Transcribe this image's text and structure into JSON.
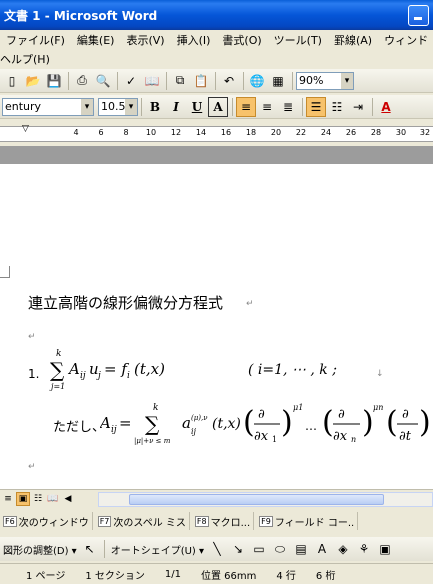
{
  "window": {
    "title": "文書 1 - Microsoft Word"
  },
  "menu": {
    "row1": [
      "ファイル(F)",
      "編集(E)",
      "表示(V)",
      "挿入(I)",
      "書式(O)",
      "ツール(T)",
      "罫線(A)",
      "ウィンド"
    ],
    "row2": [
      "ヘルプ(H)"
    ]
  },
  "standard_toolbar": {
    "zoom": "90%"
  },
  "format_toolbar": {
    "font": "entury",
    "size": "10.5"
  },
  "ruler": {
    "labels": [
      "4",
      "6",
      "8",
      "10",
      "12",
      "14",
      "16",
      "18",
      "20",
      "22",
      "24",
      "26",
      "28",
      "30",
      "32"
    ]
  },
  "document": {
    "heading": "連立高階の線形偏微分方程式",
    "eq_number": "1.",
    "eq_index": "( i=1, ⋯ , k ;",
    "note_prefix": "ただし、",
    "eq1_lhs": "A",
    "eq1_sum_upper": "k",
    "eq1_sum_lower": "j=1",
    "eq1_body": "A",
    "eq1_rhs": "= f",
    "eq2_lhs": "A",
    "eq2_sum_upper": "k",
    "eq2_sum_lower": "|μ|+ν ≤ m",
    "eq2_body": "a",
    "eq2_args": "(t,x)"
  },
  "fn_bar": [
    {
      "key": "F6",
      "label": "次のウィンドウ"
    },
    {
      "key": "F7",
      "label": "次のスペル ミス"
    },
    {
      "key": "F8",
      "label": "マクロ..."
    },
    {
      "key": "F9",
      "label": "フィールド コー.."
    }
  ],
  "drawing_toolbar": {
    "adjust": "図形の調整(D) ▾",
    "autoshape": "オートシェイプ(U) ▾"
  },
  "status": {
    "page": "1 ページ",
    "section": "1 セクション",
    "pages": "1/1",
    "position": "位置 66mm",
    "line": "4 行",
    "col": "6 桁"
  }
}
